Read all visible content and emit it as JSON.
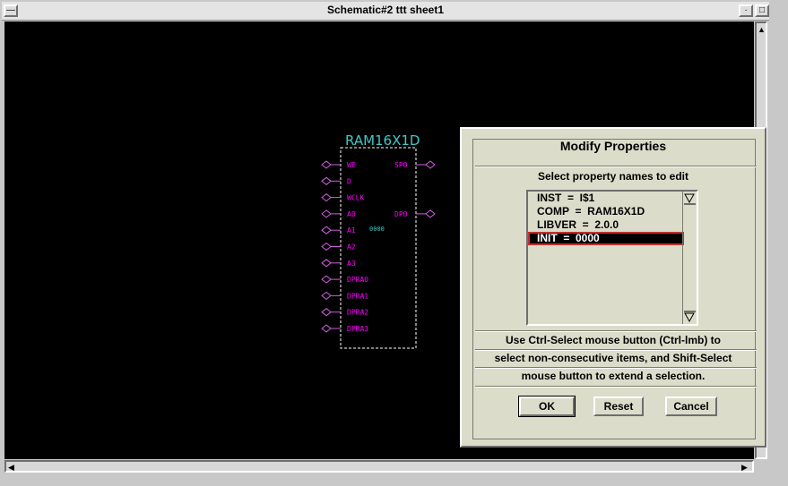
{
  "window": {
    "title": "Schematic#2 ttt sheet1",
    "menu_icon": "dash-icon",
    "min_icon": "minimize-icon",
    "max_icon": "maximize-icon"
  },
  "schematic": {
    "component_name": "RAM16X1D",
    "init_value": "0000",
    "input_pins": [
      "WE",
      "D",
      "WCLK",
      "A0",
      "A1",
      "A2",
      "A3",
      "DPRA0",
      "DPRA1",
      "DPRA2",
      "DPRA3"
    ],
    "output_pins": [
      "SPO",
      "DPO"
    ],
    "colors": {
      "title": "#40c8c8",
      "pin_label": "#ff00ff",
      "pin_marker": "#d060e0",
      "body": "#ffffff",
      "init": "#40c8c8"
    }
  },
  "dialog": {
    "title": "Modify Properties",
    "subtitle": "Select property names to edit",
    "properties": [
      {
        "label": "INST  =  I$1",
        "selected": false
      },
      {
        "label": "COMP  =  RAM16X1D",
        "selected": false
      },
      {
        "label": "LIBVER  =  2.0.0",
        "selected": false
      },
      {
        "label": "INIT  =  0000",
        "selected": true
      }
    ],
    "help": [
      "Use Ctrl-Select mouse button (Ctrl-lmb) to",
      "select non-consecutive items, and Shift-Select",
      "mouse button to extend a selection."
    ],
    "ok_label": "OK",
    "reset_label": "Reset",
    "cancel_label": "Cancel"
  }
}
